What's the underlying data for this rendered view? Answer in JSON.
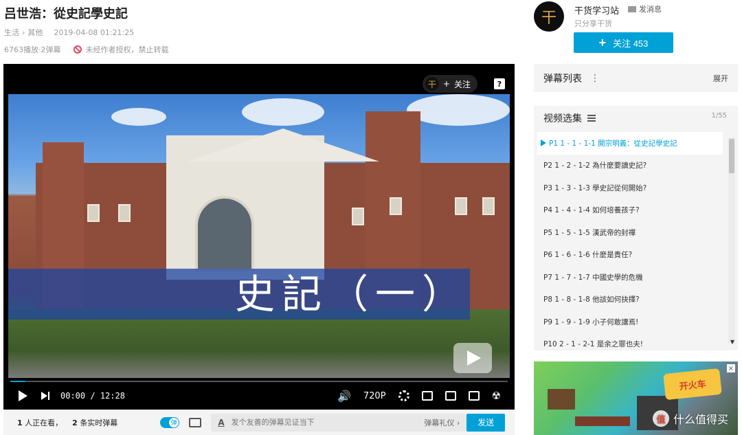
{
  "video": {
    "title": "吕世浩：從史記學史記",
    "category": "生活",
    "subcategory": "其他",
    "breadcrumb_sep": "›",
    "publish_time": "2019-04-08 01:21:25",
    "plays": "6763播放",
    "danmaku_total": "2弹幕",
    "stats_sep": "·",
    "copyright_note": "未经作者授权，禁止转载",
    "caption_overlay": "史記（一）",
    "progress_fraction": 0.03
  },
  "player": {
    "follow_overlay": "关注",
    "follow_plus": "+",
    "logo_char": "干",
    "help_label": "?",
    "current_time": "00:00",
    "time_sep": "/",
    "duration": "12:28",
    "quality": "720P"
  },
  "bottom": {
    "watching_count": "1",
    "watching_label": "人正在看，",
    "realtime_count": "2",
    "realtime_label": "条实时弹幕",
    "toggle_label": "弹",
    "input_placeholder": "发个友善的弹幕见证当下",
    "etiquette": "弹幕礼仪 ›",
    "send": "发送"
  },
  "uploader": {
    "avatar_char": "干",
    "name": "干货学习站",
    "message": "发消息",
    "description": "只分享干货",
    "follow_label": "关注 453",
    "follow_plus": "+"
  },
  "danmaku_list": {
    "label": "弹幕列表",
    "menu": "⋮",
    "expand": "展开"
  },
  "episodes": {
    "label": "视频选集",
    "count": "1/55",
    "items": [
      "P1  1 - 1 - 1-1 開宗明義：從史記學史記",
      "P2  1 - 2 - 1-2 為什麼要讀史記?",
      "P3  1 - 3 - 1-3 學史記從何開始?",
      "P4  1 - 4 - 1-4 如何培養孩子?",
      "P5  1 - 5 - 1-5 漢武帝的封禪",
      "P6  1 - 6 - 1-6 什麼是責任?",
      "P7  1 - 7 - 1-7 中國史學的危機",
      "P8  1 - 8 - 1-8 他該如何抉擇?",
      "P9  1 - 9 - 1-9 小子何敢讓焉!",
      "P10  2 - 1 - 2-1 是余之罪也夫!"
    ],
    "active_index": 0,
    "scroll_down": "▼"
  },
  "ad": {
    "logo_text": "开火车",
    "close": "×"
  },
  "watermark": {
    "logo": "值",
    "text": "什么值得买"
  },
  "colors": {
    "accent": "#00a1d6",
    "warning": "#e84a5f"
  }
}
